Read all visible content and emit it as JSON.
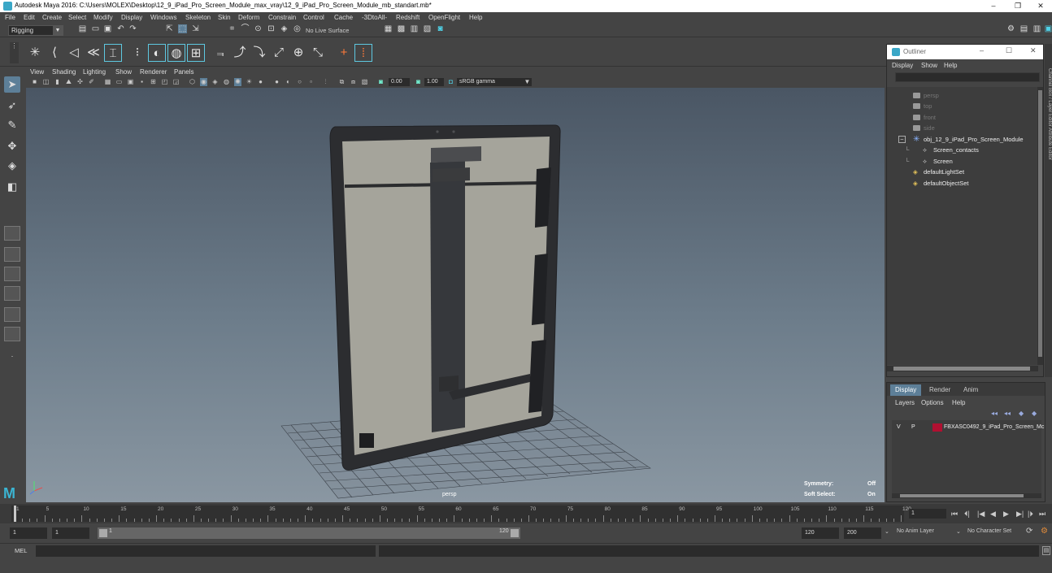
{
  "window": {
    "title": "Autodesk Maya 2016: C:\\Users\\MOLEX\\Desktop\\12_9_iPad_Pro_Screen_Module_max_vray\\12_9_iPad_Pro_Screen_Module_mb_standart.mb*",
    "minimize": "–",
    "restore": "❐",
    "close": "✕"
  },
  "menubar": [
    "File",
    "Edit",
    "Create",
    "Select",
    "Modify",
    "Display",
    "Windows",
    "Skeleton",
    "Skin",
    "Deform",
    "Constrain",
    "Control",
    "Cache",
    "-3DtoAll-",
    "Redshift",
    "OpenFlight",
    "Help"
  ],
  "statusline": {
    "mode": "Rigging",
    "live_surface": "No Live Surface"
  },
  "viewport": {
    "menu": [
      "View",
      "Shading",
      "Lighting",
      "Show",
      "Renderer",
      "Panels"
    ],
    "near_value": "0.00",
    "far_value": "1.00",
    "color_space": "sRGB gamma",
    "camera_label": "persp",
    "hud": {
      "symmetry_label": "Symmetry:",
      "symmetry_value": "Off",
      "soft_select_label": "Soft Select:",
      "soft_select_value": "On"
    }
  },
  "outliner": {
    "title": "Outliner",
    "menu": [
      "Display",
      "Show",
      "Help"
    ],
    "items": [
      {
        "label": "persp",
        "type": "camera"
      },
      {
        "label": "top",
        "type": "camera"
      },
      {
        "label": "front",
        "type": "camera"
      },
      {
        "label": "side",
        "type": "camera"
      },
      {
        "label": "obj_12_9_iPad_Pro_Screen_Module",
        "type": "group",
        "expander": "−"
      },
      {
        "label": "Screen_contacts",
        "type": "mesh"
      },
      {
        "label": "Screen",
        "type": "mesh"
      },
      {
        "label": "defaultLightSet",
        "type": "set"
      },
      {
        "label": "defaultObjectSet",
        "type": "set"
      }
    ],
    "side_strip": "Channel Box / Layer Editor   Attribute Editor"
  },
  "layer_panel": {
    "tabs": [
      "Display",
      "Render",
      "Anim"
    ],
    "active_tab": "Display",
    "menu": [
      "Layers",
      "Options",
      "Help"
    ],
    "layer": {
      "v": "V",
      "p": "P",
      "name": "FBXASC0492_9_iPad_Pro_Screen_Mc",
      "color": "#b01031"
    }
  },
  "timeline": {
    "ticks": [
      1,
      5,
      10,
      15,
      20,
      25,
      30,
      35,
      40,
      45,
      50,
      55,
      60,
      65,
      70,
      75,
      80,
      85,
      90,
      95,
      100,
      105,
      110,
      115,
      120
    ],
    "current_frame": "1",
    "playback_buttons": [
      "⏮",
      "⏴|",
      "|◀",
      "◀",
      "▶",
      "▶|",
      "|⏵",
      "⏭"
    ]
  },
  "range": {
    "start": "1",
    "playback_start": "1",
    "range_start_label": "1",
    "range_end_label": "120",
    "playback_end": "120",
    "end": "200",
    "anim_layer": "No Anim Layer",
    "character_set": "No Character Set"
  },
  "cmdline": {
    "label": "MEL"
  },
  "colors": {
    "accent": "#5d7f98",
    "maya_blue": "#3aa7c7",
    "layer_red": "#b01031"
  }
}
